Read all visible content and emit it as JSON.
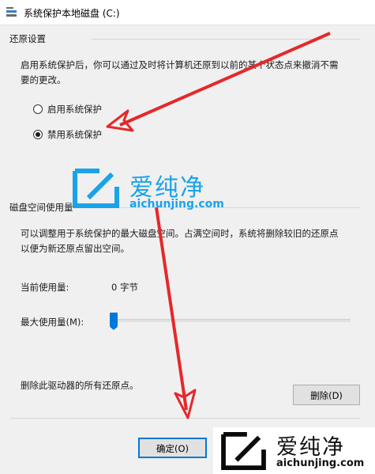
{
  "window": {
    "title": "系统保护本地磁盘 (C:)"
  },
  "restore_settings": {
    "group_label": "还原设置",
    "description_line1": "启用系统保护后，你可以通过及时将计算机还原到以前的某个状态点来撤消不需",
    "description_line2": "要的更改。",
    "options": [
      {
        "label": "启用系统保护",
        "selected": false
      },
      {
        "label": "禁用系统保护",
        "selected": true
      }
    ]
  },
  "disk_usage": {
    "group_label": "磁盘空间使用量",
    "description_line1": "可以调整用于系统保护的最大磁盘空间。占满空间时，系统将删除较旧的还原点",
    "description_line2": "以便为新还原点留出空间。",
    "current_usage_label": "当前使用量:",
    "current_usage_value": "0 字节",
    "max_usage_label": "最大使用量(M):",
    "max_usage_percent": 0
  },
  "delete_section": {
    "text": "删除此驱动器的所有还原点。",
    "delete_button": "删除(D)"
  },
  "footer": {
    "ok_button": "确定(O)"
  },
  "watermarks": [
    {
      "brand": "爱纯净",
      "url": "aichunjing.com"
    },
    {
      "brand": "爱纯净",
      "url": "aichunjing.com"
    }
  ],
  "colors": {
    "accent": "#0078d7",
    "arrow": "#e5282a",
    "watermark": "#1aa3e8"
  }
}
